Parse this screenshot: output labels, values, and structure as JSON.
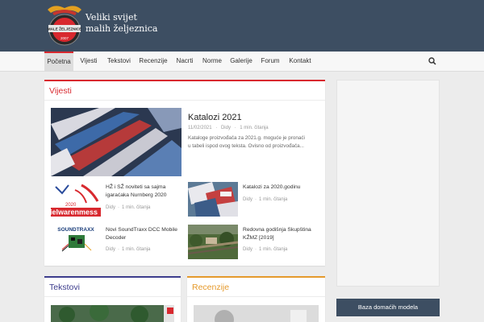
{
  "site": {
    "tagline_line1": "Veliki svijet",
    "tagline_line2": "malih željeznica",
    "logo_text_top": "MALE ŽELJEZNICE",
    "logo_year": "2007"
  },
  "nav": {
    "items": [
      "Početna",
      "Vijesti",
      "Tekstovi",
      "Recenzije",
      "Nacrti",
      "Norme",
      "Galerije",
      "Forum",
      "Kontakt"
    ],
    "active": "Početna"
  },
  "colors": {
    "header": "#3d4e62",
    "accent_red": "#d8292f",
    "accent_blue": "#3c3c8c",
    "accent_orange": "#e59a2c"
  },
  "vijesti": {
    "title": "Vijesti",
    "featured": {
      "title": "Katalozi 2021",
      "date": "11/02/2021",
      "author": "Didy",
      "read": "1 min. čitanja",
      "excerpt_line1": "Kataloge proizvođača za 2021.g. moguće je pronaći",
      "excerpt_line2": "u tabeli ispod ovog teksta. Ovisno od proizvođača..."
    },
    "posts": [
      {
        "title_line1": "HŽ i SŽ noviteti sa sajma",
        "title_line2": "igaraćaka Nurnberg 2020",
        "author": "Didy",
        "read": "1 min. čitanja",
        "thumb_text": "ielwarenmess",
        "thumb_year": "2020"
      },
      {
        "title_line1": "Katalozi za 2020.godinu",
        "title_line2": "",
        "author": "Didy",
        "read": "1 min. čitanja"
      },
      {
        "title_line1": "Novi SoundTraxx DCC Mobile",
        "title_line2": "Decoder",
        "author": "Didy",
        "read": "1 min. čitanja",
        "thumb_text": "SOUNDTRAXX"
      },
      {
        "title_line1": "Redovna godišnja Skupština",
        "title_line2": "KŽMZ [2019]",
        "author": "Didy",
        "read": "1 min. čitanja"
      }
    ]
  },
  "tekstovi": {
    "title": "Tekstovi"
  },
  "recenzije": {
    "title": "Recenzije"
  },
  "sidebar": {
    "button": "Baza domaćih modela"
  }
}
